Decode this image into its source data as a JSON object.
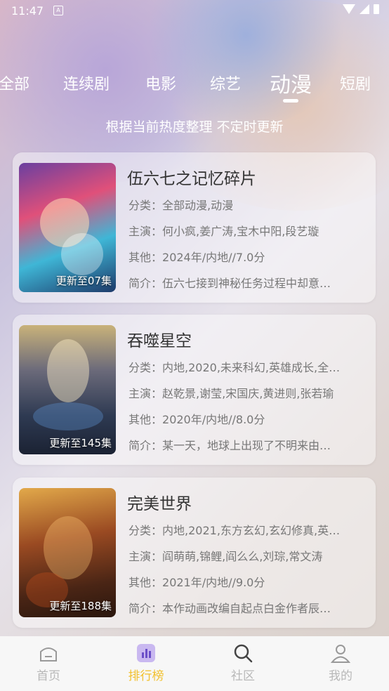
{
  "status": {
    "time": "11:47",
    "indicator": "A"
  },
  "tabs": [
    {
      "label": "全部"
    },
    {
      "label": "连续剧"
    },
    {
      "label": "电影"
    },
    {
      "label": "综艺"
    },
    {
      "label": "动漫"
    },
    {
      "label": "短剧"
    }
  ],
  "active_tab": "动漫",
  "subtitle": "根据当前热度整理 不定时更新",
  "labels": {
    "category": "分类：",
    "cast": "主演：",
    "other": "其他：",
    "intro": "简介："
  },
  "items": [
    {
      "title": "伍六七之记忆碎片",
      "episode": "更新至07集",
      "category": "全部动漫,动漫",
      "cast": "何小疯,姜广涛,宝木中阳,段艺璇",
      "other": "2024年/内地//7.0分",
      "intro": "伍六七接到神秘任务过程中却意…"
    },
    {
      "title": "吞噬星空",
      "episode": "更新至145集",
      "category": "内地,2020,未来科幻,英雄成长,全…",
      "cast": "赵乾景,谢莹,宋国庆,黄进则,张若瑜",
      "other": "2020年/内地//8.0分",
      "intro": "某一天，地球上出现了不明来由…"
    },
    {
      "title": "完美世界",
      "episode": "更新至188集",
      "category": "内地,2021,东方玄幻,玄幻修真,英…",
      "cast": "阎萌萌,锦鲤,阎么么,刘琮,常文涛",
      "other": "2021年/内地//9.0分",
      "intro": "本作动画改编自起点白金作者辰…"
    }
  ],
  "nav": [
    {
      "label": "首页",
      "icon": "home-icon"
    },
    {
      "label": "排行榜",
      "icon": "ranking-icon"
    },
    {
      "label": "社区",
      "icon": "search-icon"
    },
    {
      "label": "我的",
      "icon": "user-icon"
    }
  ],
  "colors": {
    "accent": "#f2c12e",
    "nav_inactive": "#b8b8b8"
  }
}
